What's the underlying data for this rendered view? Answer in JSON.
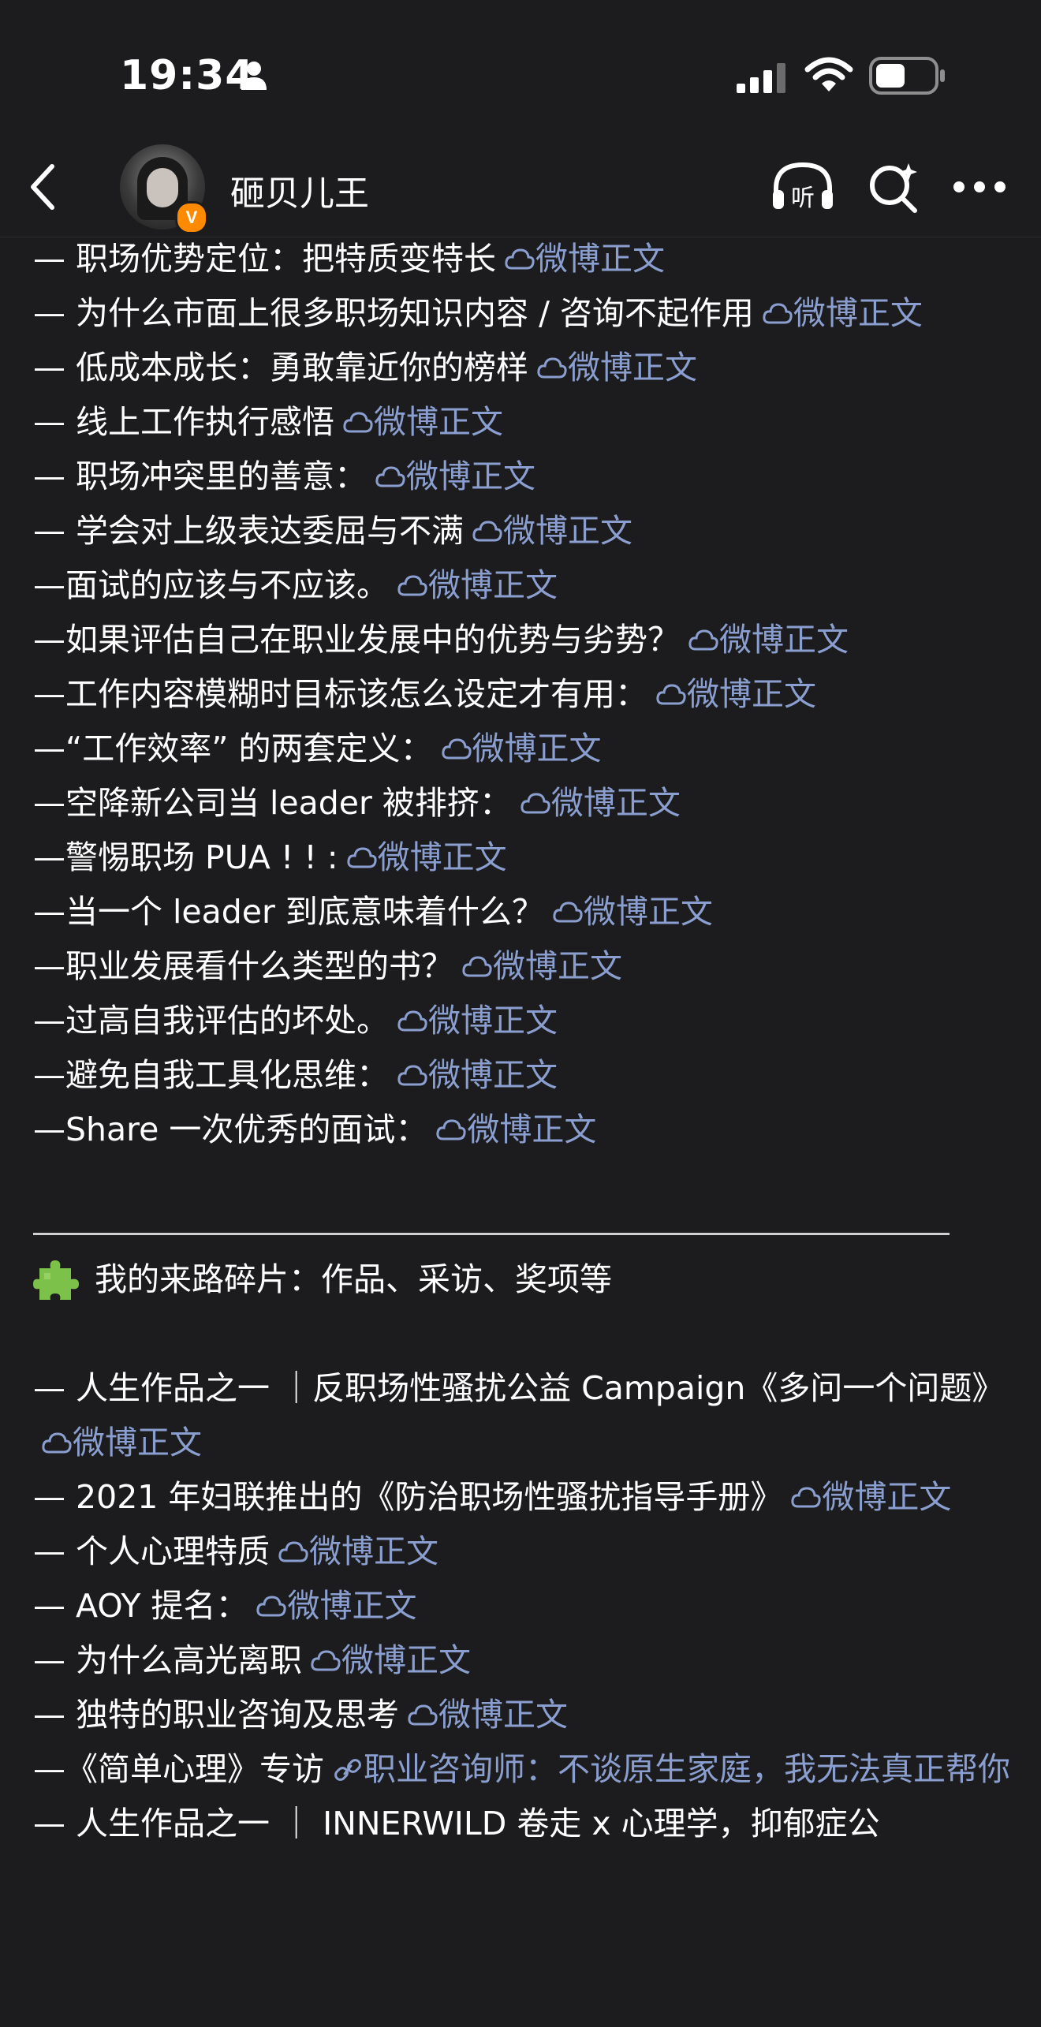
{
  "status_bar": {
    "time": "19:34"
  },
  "nav": {
    "username": "砸贝儿王",
    "verified_badge": "V"
  },
  "link_label": "微博正文",
  "lines_a": [
    {
      "prefix": "— 职场优势定位：把特质变特长",
      "link": "微博正文"
    },
    {
      "prefix": "— 为什么市面上很多职场知识内容 / 咨询不起作用",
      "link": "微博正文"
    },
    {
      "prefix": "— 低成本成长：勇敢靠近你的榜样",
      "link": "微博正文"
    },
    {
      "prefix": "— 线上工作执行感悟",
      "link": "微博正文"
    },
    {
      "prefix": "— 职场冲突里的善意：",
      "link": "微博正文"
    },
    {
      "prefix": "— 学会对上级表达委屈与不满",
      "link": "微博正文"
    },
    {
      "prefix": "—面试的应该与不应该。",
      "link": "微博正文"
    },
    {
      "prefix": "—如果评估自己在职业发展中的优势与劣势？",
      "link": "微博正文"
    },
    {
      "prefix": "—工作内容模糊时目标该怎么设定才有用：",
      "link": "微博正文"
    },
    {
      "prefix": "—“工作效率” 的两套定义：",
      "link": "微博正文"
    },
    {
      "prefix": "—空降新公司当 leader 被排挤：",
      "link": "微博正文"
    },
    {
      "prefix": "—警惕职场 PUA ! ! :",
      "link": "微博正文"
    },
    {
      "prefix": "—当一个 leader 到底意味着什么？",
      "link": "微博正文"
    },
    {
      "prefix": "—职业发展看什么类型的书？",
      "link": "微博正文"
    },
    {
      "prefix": "—过高自我评估的坏处。",
      "link": "微博正文"
    },
    {
      "prefix": "—避免自我工具化思维：",
      "link": "微博正文"
    },
    {
      "prefix": "—Share 一次优秀的面试：",
      "link": "微博正文"
    }
  ],
  "section": {
    "heading": "我的来路碎片：作品、采访、奖项等"
  },
  "lines_b": [
    {
      "prefix": "— 人生作品之一 ｜反职场性骚扰公益 Campaign《多问一个问题》",
      "link": "微博正文",
      "type": "weibo"
    },
    {
      "prefix": "— 2021 年妇联推出的《防治职场性骚扰指导手册》",
      "link": "微博正文",
      "type": "weibo"
    },
    {
      "prefix": "— 个人心理特质",
      "link": "微博正文",
      "type": "weibo"
    },
    {
      "prefix": "— AOY 提名：",
      "link": "微博正文",
      "type": "weibo"
    },
    {
      "prefix": "— 为什么高光离职",
      "link": "微博正文",
      "type": "weibo"
    },
    {
      "prefix": "— 独特的职业咨询及思考",
      "link": "微博正文",
      "type": "weibo"
    },
    {
      "prefix": "—《简单心理》专访",
      "link": "职业咨询师：不谈原生家庭，我无法真正帮你",
      "type": "chain"
    },
    {
      "prefix": "— 人生作品之一 ｜ INNERWILD 卷走 x 心理学，抑郁症公",
      "link": "",
      "type": "none"
    }
  ]
}
